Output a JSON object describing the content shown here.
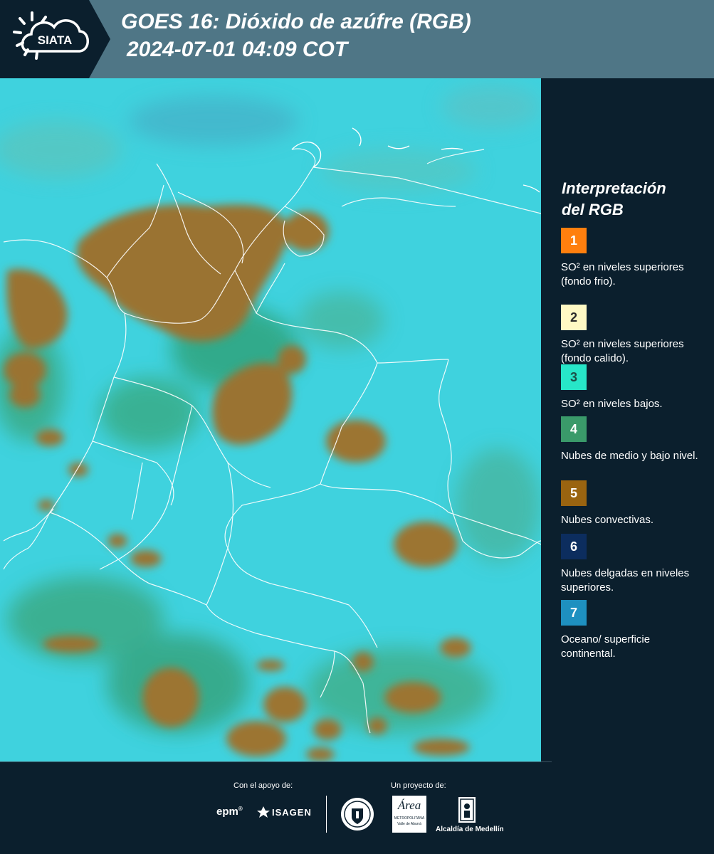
{
  "header": {
    "logo_text": "SIATA",
    "title_line1": "GOES 16: Dióxido de azúfre (RGB)",
    "title_line2": "2024-07-01 04:09 COT"
  },
  "legend": {
    "title_line1": "Interpretación",
    "title_line2": "del RGB",
    "items": [
      {
        "number": "1",
        "text": "SO² en niveles superiores (fondo frio).",
        "color": "#ff7f0e"
      },
      {
        "number": "2",
        "text": "SO² en niveles superiores (fondo calido).",
        "color": "#fff9c4"
      },
      {
        "number": "3",
        "text": "SO² en niveles bajos.",
        "color": "#27e6c8"
      },
      {
        "number": "4",
        "text": "Nubes de medio y bajo nivel.",
        "color": "#3a9a6a"
      },
      {
        "number": "5",
        "text": "Nubes convectivas.",
        "color": "#9a6410"
      },
      {
        "number": "6",
        "text": "Nubes delgadas en niveles superiores.",
        "color": "#0c2d5e"
      },
      {
        "number": "7",
        "text": "Oceano/ superficie continental.",
        "color": "#1e90c0"
      }
    ]
  },
  "footer": {
    "support_label": "Con el apoyo de:",
    "project_label": "Un proyecto de:",
    "epm_logo": "epm",
    "isagen_logo": "ISAGEN",
    "area_logo_title": "Área",
    "area_logo_sub1": "METROPOLITANA",
    "area_logo_sub2": "Valle de Aburrá",
    "alcaldia_label": "Alcaldía de Medellín"
  },
  "colors": {
    "background": "#0b1f2d",
    "header_band": "#4f7686",
    "map_base": "#3fd2de",
    "cloud_brown": "#9c7030",
    "cloud_green": "#2f9a70"
  }
}
